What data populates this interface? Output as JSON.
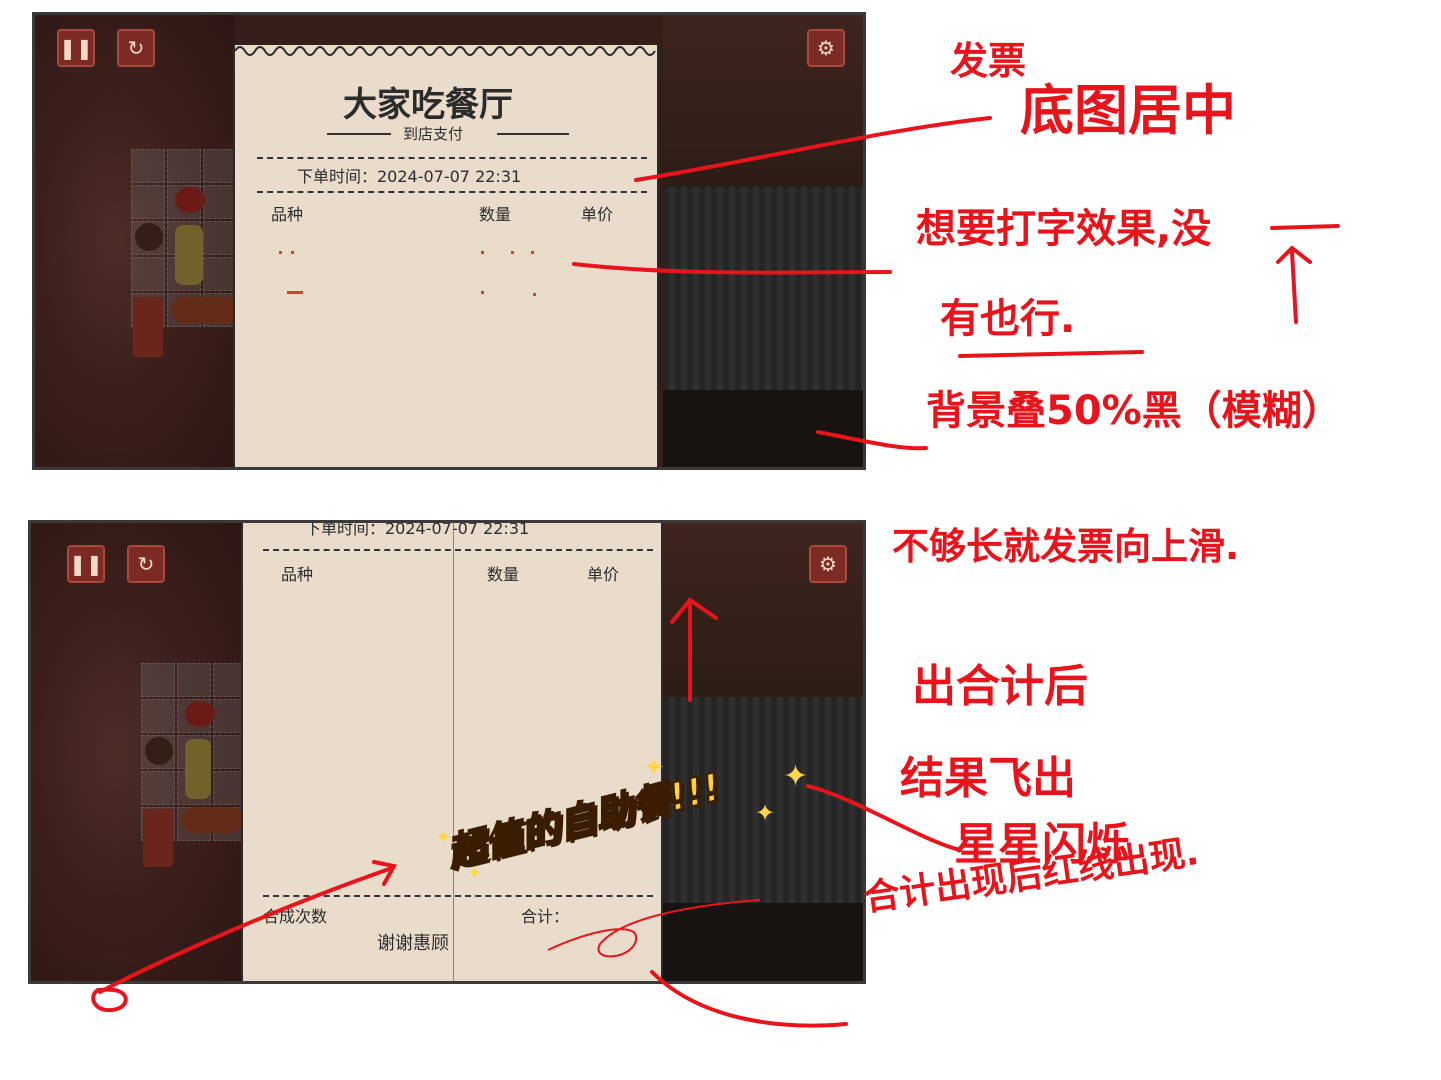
{
  "receipt": {
    "restaurant_name": "大家吃餐厅",
    "pay_method": "到店支付",
    "order_time": "下单时间：2024-07-07    22:31",
    "col_item": "品种",
    "col_qty": "数量",
    "col_price": "单价",
    "combo_count_label": "合成次数",
    "total_label": "合计：",
    "thanks": "谢谢惠顾"
  },
  "result_badge": "超值的自助餐!!!",
  "annotations": {
    "a1_small": "发票",
    "a1_big": "底图居中",
    "a2_line1": "想要打字效果,没",
    "a2_line2": "有也行.",
    "a3": "背景叠50%黑（模糊）",
    "a4": "不够长就发票向上滑.",
    "a5": "出合计后",
    "a6_line1": "结果飞出",
    "a6_line2": "星星闪烁",
    "a7": "合计出现后红线出现."
  },
  "icons": [
    "pause-icon",
    "restart-icon",
    "settings-icon"
  ],
  "colors": {
    "annotation_red": "#e8141c",
    "receipt_paper": "#eadccb",
    "button_red": "#7b2a24"
  }
}
